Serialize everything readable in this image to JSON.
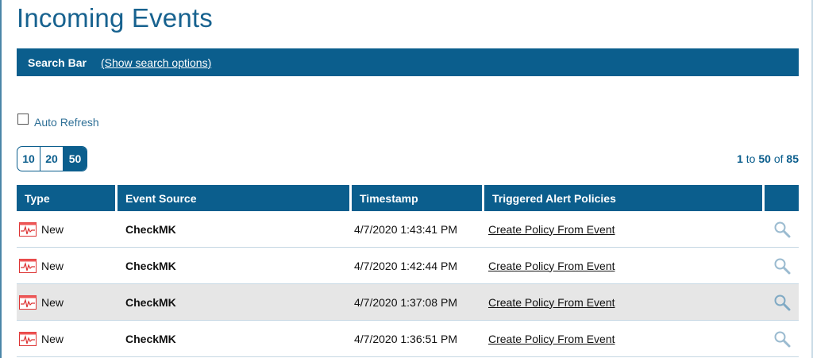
{
  "page": {
    "title": "Incoming Events"
  },
  "search_bar": {
    "label": "Search Bar",
    "link": "(Show search options)"
  },
  "auto_refresh": {
    "label": "Auto Refresh",
    "checked": false
  },
  "pager": {
    "sizes": [
      "10",
      "20",
      "50"
    ],
    "selected": "50"
  },
  "range": {
    "from": "1",
    "to_word": "to",
    "to": "50",
    "of_word": "of",
    "total": "85"
  },
  "table": {
    "headers": {
      "type": "Type",
      "source": "Event Source",
      "timestamp": "Timestamp",
      "policies": "Triggered Alert Policies"
    },
    "rows": [
      {
        "type": "New",
        "source": "CheckMK",
        "timestamp": "4/7/2020 1:43:41 PM",
        "policy": "Create Policy From Event"
      },
      {
        "type": "New",
        "source": "CheckMK",
        "timestamp": "4/7/2020 1:42:44 PM",
        "policy": "Create Policy From Event"
      },
      {
        "type": "New",
        "source": "CheckMK",
        "timestamp": "4/7/2020 1:37:08 PM",
        "policy": "Create Policy From Event"
      },
      {
        "type": "New",
        "source": "CheckMK",
        "timestamp": "4/7/2020 1:36:51 PM",
        "policy": "Create Policy From Event"
      }
    ]
  },
  "icons": {
    "type": "event-pulse-icon",
    "row_action": "magnifier-icon"
  },
  "colors": {
    "primary": "#0b5e8d",
    "title": "#17628f",
    "row_highlight": "#e6e6e6"
  }
}
